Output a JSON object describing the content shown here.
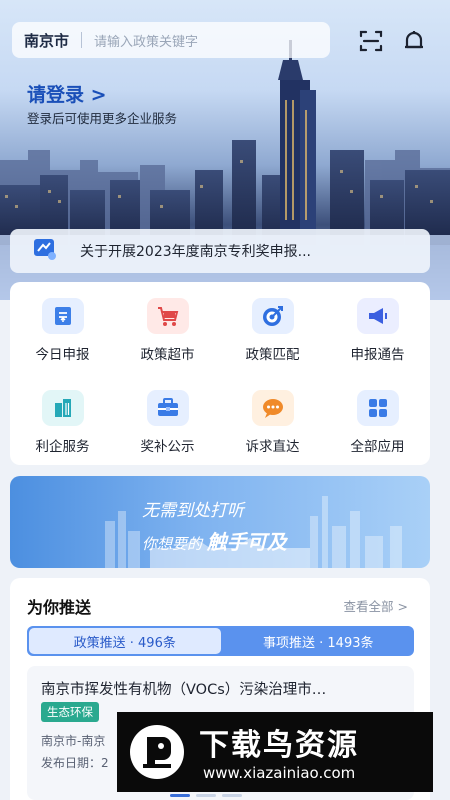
{
  "header": {
    "city": "南京市",
    "search_placeholder": "请输入政策关键字",
    "icons": [
      "scan-icon",
      "bell-icon"
    ]
  },
  "login": {
    "title": "请登录 >",
    "subtitle": "登录后可使用更多企业服务"
  },
  "notice": {
    "icon": "announcement-icon",
    "text": "关于开展2023年度南京专利奖申报..."
  },
  "grid": {
    "items": [
      {
        "label": "今日申报",
        "icon": "report-upload-icon",
        "color": "#3d7fe8",
        "bg": "#e6efff"
      },
      {
        "label": "政策超市",
        "icon": "cart-icon",
        "color": "#e04848",
        "bg": "#ffe9e7"
      },
      {
        "label": "政策匹配",
        "icon": "target-icon",
        "color": "#2f6fe0",
        "bg": "#e6efff"
      },
      {
        "label": "申报通告",
        "icon": "megaphone-icon",
        "color": "#3b5fe0",
        "bg": "#ebeeff"
      },
      {
        "label": "利企服务",
        "icon": "building-icon",
        "color": "#25a8b7",
        "bg": "#e2f6f7"
      },
      {
        "label": "奖补公示",
        "icon": "toolbox-icon",
        "color": "#3a7be6",
        "bg": "#e6efff"
      },
      {
        "label": "诉求直达",
        "icon": "chat-icon",
        "color": "#f08a2a",
        "bg": "#fff0e0"
      },
      {
        "label": "全部应用",
        "icon": "apps-grid-icon",
        "color": "#3a7be6",
        "bg": "#e6efff"
      }
    ]
  },
  "banner": {
    "line1": "无需到处打听",
    "line2_pre": "你想要的",
    "line2_big": "触手可及"
  },
  "recommend": {
    "title": "为你推送",
    "more": "查看全部 >",
    "tabs": [
      {
        "label": "政策推送 · 496条",
        "active": true
      },
      {
        "label": "事项推送 · 1493条",
        "active": false
      }
    ],
    "item": {
      "title": "南京市挥发性有机物（VOCs）污染治理市…",
      "tag": "生态环保",
      "meta1": "南京市-南京",
      "meta2": "发布日期：2"
    }
  },
  "watermark": {
    "cn": "下载鸟资源",
    "url": "www.xiazainiao.com"
  },
  "colors": {
    "accent": "#1a4fb8",
    "tab_bg": "#5a92ee",
    "tag": "#2aa98f"
  }
}
